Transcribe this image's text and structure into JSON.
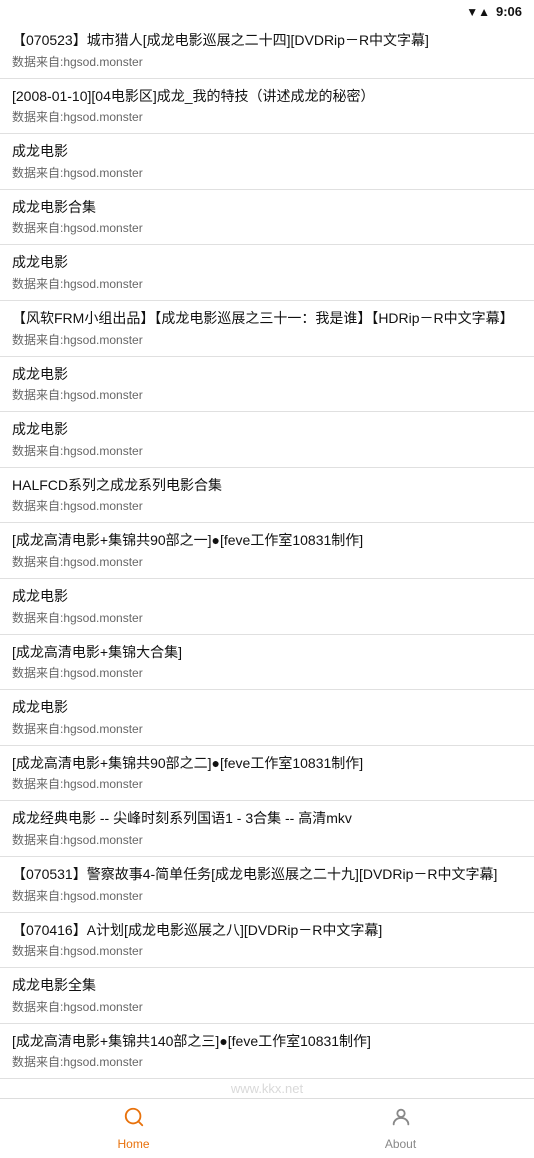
{
  "statusBar": {
    "time": "9:06",
    "signal": "▼",
    "wifi": "▲"
  },
  "watermark": "www.kkx.net",
  "items": [
    {
      "title": "【070523】城市猎人[成龙电影巡展之二十四][DVDRip－R中文字幕]",
      "source": "数据来自:hgsod.monster"
    },
    {
      "title": "[2008-01-10][04电影区]成龙_我的特技（讲述成龙的秘密）",
      "source": "数据来自:hgsod.monster"
    },
    {
      "title": "成龙电影",
      "source": "数据来自:hgsod.monster"
    },
    {
      "title": "成龙电影合集",
      "source": "数据来自:hgsod.monster"
    },
    {
      "title": "成龙电影",
      "source": "数据来自:hgsod.monster"
    },
    {
      "title": "【风软FRM小组出品】【成龙电影巡展之三十一：我是谁】【HDRip－R中文字幕】",
      "source": "数据来自:hgsod.monster"
    },
    {
      "title": "成龙电影",
      "source": "数据来自:hgsod.monster"
    },
    {
      "title": "成龙电影",
      "source": "数据来自:hgsod.monster"
    },
    {
      "title": "HALFCD系列之成龙系列电影合集",
      "source": "数据来自:hgsod.monster"
    },
    {
      "title": "[成龙高清电影+集锦共90部之一]●[feve工作室10831制作]",
      "source": "数据来自:hgsod.monster"
    },
    {
      "title": "成龙电影",
      "source": "数据来自:hgsod.monster"
    },
    {
      "title": "[成龙高清电影+集锦大合集]",
      "source": "数据来自:hgsod.monster"
    },
    {
      "title": "成龙电影",
      "source": "数据来自:hgsod.monster"
    },
    {
      "title": "[成龙高清电影+集锦共90部之二]●[feve工作室10831制作]",
      "source": "数据来自:hgsod.monster"
    },
    {
      "title": "成龙经典电影 -- 尖峰时刻系列国语1 - 3合集 -- 高清mkv",
      "source": "数据来自:hgsod.monster"
    },
    {
      "title": "【070531】警察故事4-简单任务[成龙电影巡展之二十九][DVDRip－R中文字幕]",
      "source": "数据来自:hgsod.monster"
    },
    {
      "title": "【070416】A计划[成龙电影巡展之八][DVDRip－R中文字幕]",
      "source": "数据来自:hgsod.monster"
    },
    {
      "title": "成龙电影全集",
      "source": "数据来自:hgsod.monster"
    },
    {
      "title": "[成龙高清电影+集锦共140部之三]●[feve工作室10831制作]",
      "source": "数据来自:hgsod.monster"
    }
  ],
  "bottomNav": {
    "items": [
      {
        "id": "home",
        "label": "Home",
        "active": true,
        "icon": "search"
      },
      {
        "id": "about",
        "label": "About",
        "active": false,
        "icon": "person"
      }
    ]
  }
}
